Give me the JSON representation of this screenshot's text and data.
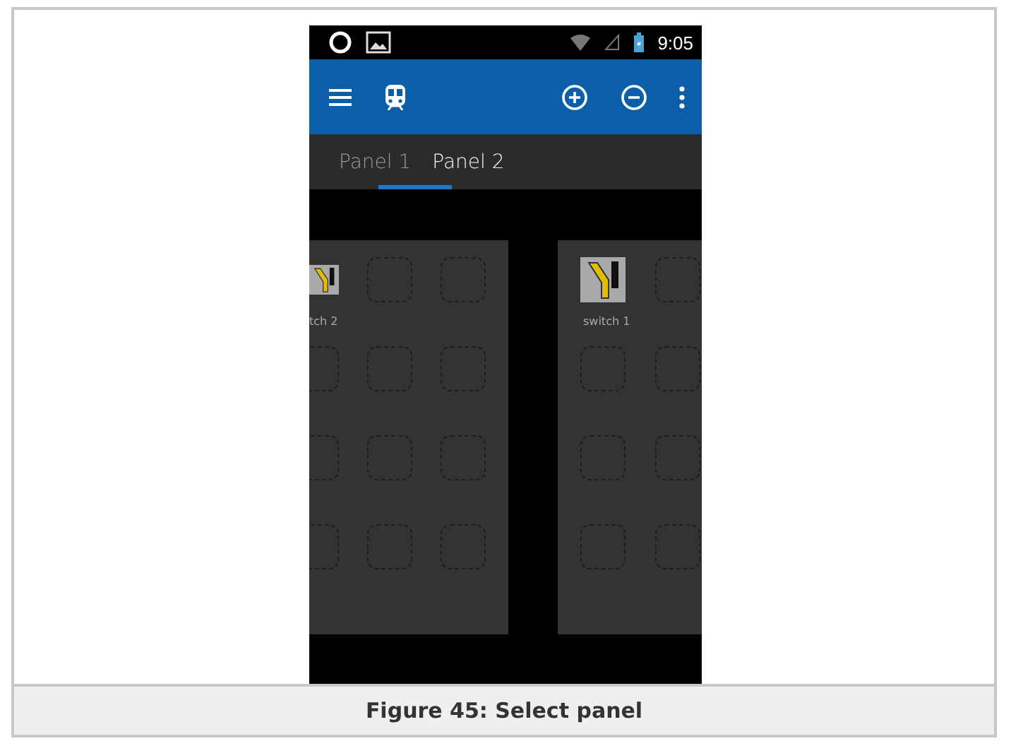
{
  "status_bar": {
    "time": "9:05"
  },
  "tabs": [
    {
      "label": "Panel 1",
      "selected": false
    },
    {
      "label": "Panel 2",
      "selected": true
    }
  ],
  "panels": [
    {
      "cells": [
        {
          "kind": "switch",
          "label": "tch 2"
        },
        {
          "kind": "empty"
        },
        {
          "kind": "empty"
        },
        {
          "kind": "empty"
        },
        {
          "kind": "empty"
        },
        {
          "kind": "empty"
        },
        {
          "kind": "empty"
        },
        {
          "kind": "empty"
        },
        {
          "kind": "empty"
        },
        {
          "kind": "empty"
        },
        {
          "kind": "empty"
        },
        {
          "kind": "empty"
        }
      ]
    },
    {
      "cells": [
        {
          "kind": "switch",
          "label": "switch 1"
        },
        {
          "kind": "empty"
        },
        {
          "kind": "empty"
        },
        {
          "kind": "empty"
        },
        {
          "kind": "empty"
        },
        {
          "kind": "empty"
        },
        {
          "kind": "empty"
        },
        {
          "kind": "empty"
        }
      ]
    }
  ],
  "caption": "Figure 45: Select panel"
}
